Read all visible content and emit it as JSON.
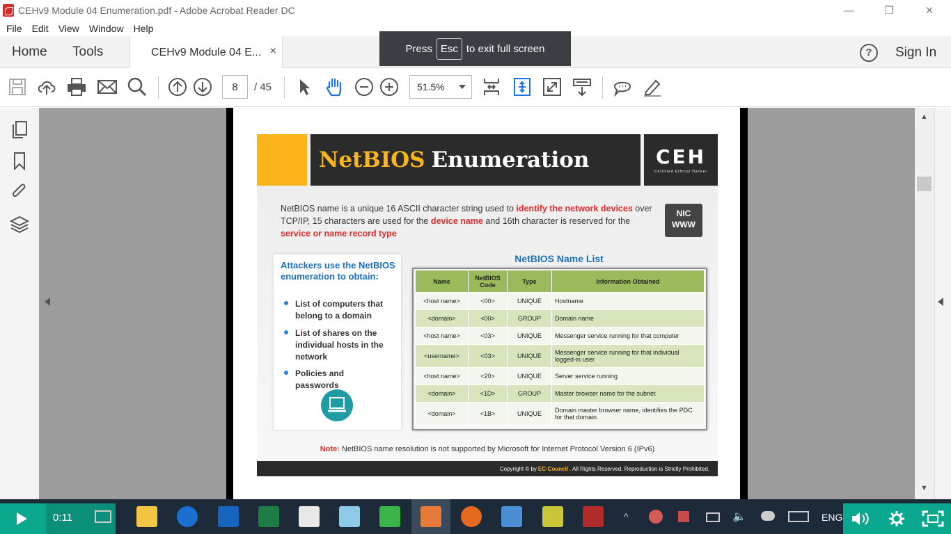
{
  "window": {
    "title": "CEHv9 Module 04 Enumeration.pdf - Adobe Acrobat Reader DC",
    "minimize": "—",
    "restore": "❐",
    "close": "✕"
  },
  "menu": [
    "File",
    "Edit",
    "View",
    "Window",
    "Help"
  ],
  "tabs": {
    "home": "Home",
    "tools": "Tools",
    "doc": "CEHv9 Module 04 E...",
    "doc_close": "×",
    "signin": "Sign In",
    "help": "?"
  },
  "fullscreen_tip": {
    "press": "Press",
    "key": "Esc",
    "rest": "to exit full screen"
  },
  "toolbar": {
    "page_current": "8",
    "page_total": "/  45",
    "zoom": "51.5%"
  },
  "slide": {
    "title_yellow": "NetBIOS",
    "title_white": "Enumeration",
    "ceh_logo": "CEH",
    "ceh_sub": "Certified Ethical Hacker",
    "intro_1": "NetBIOS name is a unique 16 ASCII character string used to ",
    "intro_red_1": "identify the network devices",
    "intro_2": " over TCP/IP, 15 characters are used for the ",
    "intro_red_2": "device name",
    "intro_3": " and 16th character is reserved for the ",
    "intro_red_3": "service or name record type",
    "nic_top": "NIC",
    "nic_bottom": "WWW",
    "side_title": "Attackers use the NetBIOS enumeration to obtain:",
    "bullets": [
      "List of computers that belong to a domain",
      "List of shares on the individual hosts in the network",
      "Policies and passwords"
    ],
    "table_title": "NetBIOS Name List",
    "table_headers": [
      "Name",
      "NetBIOS Code",
      "Type",
      "Information Obtained"
    ],
    "table_rows": [
      [
        "<host name>",
        "<00>",
        "UNIQUE",
        "Hostname"
      ],
      [
        "<domain>",
        "<00>",
        "GROUP",
        "Domain name"
      ],
      [
        "<host name>",
        "<03>",
        "UNIQUE",
        "Messenger service running for that computer"
      ],
      [
        "<username>",
        "<03>",
        "UNIQUE",
        "Messenger service running for that individual logged-in user"
      ],
      [
        "<host name>",
        "<20>",
        "UNIQUE",
        "Server service running"
      ],
      [
        "<domain>",
        "<1D>",
        "GROUP",
        "Master browser name for the subnet"
      ],
      [
        "<domain>",
        "<1B>",
        "UNIQUE",
        "Domain master browser name, identifies the PDC for that domain"
      ]
    ],
    "note_label": "Note:",
    "note_text": " NetBIOS name resolution is not supported by Microsoft for Internet Protocol Version 6 (IPv6)",
    "footer_1": "Copyright © by ",
    "footer_ec": "EC-Council",
    "footer_2": ". All Rights Reserved. Reproduction is Strictly Prohibited."
  },
  "taskbar": {
    "time": "0:11",
    "language": "ENG"
  },
  "colors": {
    "accent_yellow": "#fbb51a",
    "dark": "#2b2b2b",
    "table_green": "#9aba5c",
    "title_blue": "#1a6fbf",
    "taskbar_teal": "#0aa88f"
  }
}
